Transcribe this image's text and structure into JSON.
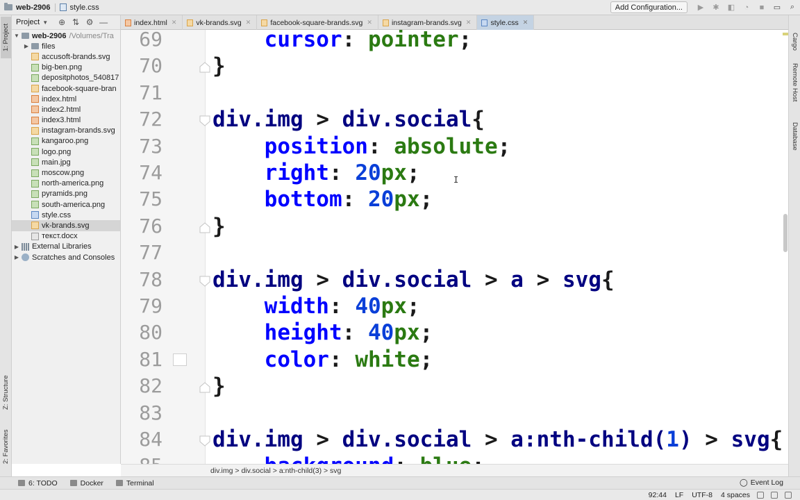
{
  "topbar": {
    "project_name": "web-2906",
    "current_file": "style.css",
    "run_config_label": "Add Configuration...",
    "icons": [
      "run-icon",
      "debug-icon",
      "coverage-icon",
      "profile-icon",
      "stop-icon",
      "window-icon",
      "search-icon"
    ]
  },
  "left_strip": {
    "project_tab": "1: Project",
    "structure_tab": "Z: Structure",
    "favorites_tab": "2: Favorites"
  },
  "right_strip": {
    "cargo_tab": "Cargo",
    "remote_host_tab": "Remote Host",
    "database_tab": "Database"
  },
  "project_panel": {
    "header_label": "Project",
    "root": {
      "name": "web-2906",
      "path": "/Volumes/Tra"
    },
    "items": [
      {
        "label": "files",
        "type": "folder",
        "expanded": false
      },
      {
        "label": "accusoft-brands.svg",
        "type": "svg"
      },
      {
        "label": "big-ben.png",
        "type": "png"
      },
      {
        "label": "depositphotos_540817",
        "type": "png"
      },
      {
        "label": "facebook-square-bran",
        "type": "svg"
      },
      {
        "label": "index.html",
        "type": "html"
      },
      {
        "label": "index2.html",
        "type": "html"
      },
      {
        "label": "index3.html",
        "type": "html"
      },
      {
        "label": "instagram-brands.svg",
        "type": "svg"
      },
      {
        "label": "kangaroo.png",
        "type": "png"
      },
      {
        "label": "logo.png",
        "type": "png"
      },
      {
        "label": "main.jpg",
        "type": "jpg"
      },
      {
        "label": "moscow.png",
        "type": "png"
      },
      {
        "label": "north-america.png",
        "type": "png"
      },
      {
        "label": "pyramids.png",
        "type": "png"
      },
      {
        "label": "south-america.png",
        "type": "png"
      },
      {
        "label": "style.css",
        "type": "css"
      },
      {
        "label": "vk-brands.svg",
        "type": "svg",
        "selected": true
      },
      {
        "label": "текст.docx",
        "type": "docx"
      }
    ],
    "external_libraries": "External Libraries",
    "scratches": "Scratches and Consoles"
  },
  "tabs": [
    {
      "label": "index.html",
      "type": "html"
    },
    {
      "label": "vk-brands.svg",
      "type": "svg"
    },
    {
      "label": "facebook-square-brands.svg",
      "type": "svg"
    },
    {
      "label": "instagram-brands.svg",
      "type": "svg"
    },
    {
      "label": "style.css",
      "type": "css",
      "active": true
    }
  ],
  "editor": {
    "lines": [
      {
        "num": "69",
        "tokens": [
          [
            "    ",
            "punc"
          ],
          [
            "cursor",
            "prop"
          ],
          [
            ": ",
            "punc"
          ],
          [
            "pointer",
            "val"
          ],
          [
            ";",
            "punc"
          ]
        ]
      },
      {
        "num": "70",
        "fold": "end",
        "tokens": [
          [
            "}",
            "punc"
          ]
        ]
      },
      {
        "num": "71",
        "tokens": []
      },
      {
        "num": "72",
        "fold": "start",
        "tokens": [
          [
            "div.img",
            "sel"
          ],
          [
            " > ",
            "punc"
          ],
          [
            "div.social",
            "sel"
          ],
          [
            "{",
            "punc"
          ]
        ]
      },
      {
        "num": "73",
        "tokens": [
          [
            "    ",
            "punc"
          ],
          [
            "position",
            "prop"
          ],
          [
            ": ",
            "punc"
          ],
          [
            "absolute",
            "val"
          ],
          [
            ";",
            "punc"
          ]
        ]
      },
      {
        "num": "74",
        "tokens": [
          [
            "    ",
            "punc"
          ],
          [
            "right",
            "prop"
          ],
          [
            ": ",
            "punc"
          ],
          [
            "20",
            "num"
          ],
          [
            "px",
            "unit"
          ],
          [
            ";",
            "punc"
          ]
        ]
      },
      {
        "num": "75",
        "tokens": [
          [
            "    ",
            "punc"
          ],
          [
            "bottom",
            "prop"
          ],
          [
            ": ",
            "punc"
          ],
          [
            "20",
            "num"
          ],
          [
            "px",
            "unit"
          ],
          [
            ";",
            "punc"
          ]
        ]
      },
      {
        "num": "76",
        "fold": "end",
        "tokens": [
          [
            "}",
            "punc"
          ]
        ]
      },
      {
        "num": "77",
        "tokens": []
      },
      {
        "num": "78",
        "fold": "start",
        "tokens": [
          [
            "div.img",
            "sel"
          ],
          [
            " > ",
            "punc"
          ],
          [
            "div.social",
            "sel"
          ],
          [
            " > ",
            "punc"
          ],
          [
            "a",
            "sel"
          ],
          [
            " > ",
            "punc"
          ],
          [
            "svg",
            "sel"
          ],
          [
            "{",
            "punc"
          ]
        ]
      },
      {
        "num": "79",
        "tokens": [
          [
            "    ",
            "punc"
          ],
          [
            "width",
            "prop"
          ],
          [
            ": ",
            "punc"
          ],
          [
            "40",
            "num"
          ],
          [
            "px",
            "unit"
          ],
          [
            ";",
            "punc"
          ]
        ]
      },
      {
        "num": "80",
        "tokens": [
          [
            "    ",
            "punc"
          ],
          [
            "height",
            "prop"
          ],
          [
            ": ",
            "punc"
          ],
          [
            "40",
            "num"
          ],
          [
            "px",
            "unit"
          ],
          [
            ";",
            "punc"
          ]
        ]
      },
      {
        "num": "81",
        "bookmark": true,
        "tokens": [
          [
            "    ",
            "punc"
          ],
          [
            "color",
            "prop"
          ],
          [
            ": ",
            "punc"
          ],
          [
            "white",
            "val"
          ],
          [
            ";",
            "punc"
          ]
        ]
      },
      {
        "num": "82",
        "fold": "end",
        "tokens": [
          [
            "}",
            "punc"
          ]
        ]
      },
      {
        "num": "83",
        "tokens": []
      },
      {
        "num": "84",
        "fold": "start",
        "tokens": [
          [
            "div.img",
            "sel"
          ],
          [
            " > ",
            "punc"
          ],
          [
            "div.social",
            "sel"
          ],
          [
            " > ",
            "punc"
          ],
          [
            "a",
            "sel"
          ],
          [
            ":nth-child(",
            "sel"
          ],
          [
            "1",
            "num"
          ],
          [
            ")",
            "sel"
          ],
          [
            " > ",
            "punc"
          ],
          [
            "svg",
            "sel"
          ],
          [
            "{",
            "punc"
          ]
        ]
      },
      {
        "num": "85",
        "tokens": [
          [
            "    ",
            "punc"
          ],
          [
            "background",
            "prop"
          ],
          [
            ": ",
            "punc"
          ],
          [
            "blue",
            "val"
          ],
          [
            ";",
            "punc"
          ]
        ]
      }
    ]
  },
  "breadcrumb": "div.img > div.social > a:nth-child(3) > svg",
  "bottom_tools": {
    "todo": "6: TODO",
    "docker": "Docker",
    "terminal": "Terminal",
    "event_log": "Event Log"
  },
  "status": {
    "position": "92:44",
    "line_sep": "LF",
    "encoding": "UTF-8",
    "indent": "4 spaces"
  },
  "colors": {
    "selector": "#000080",
    "property": "#0000ff",
    "value": "#2b7a12",
    "number": "#0a3fd8"
  }
}
